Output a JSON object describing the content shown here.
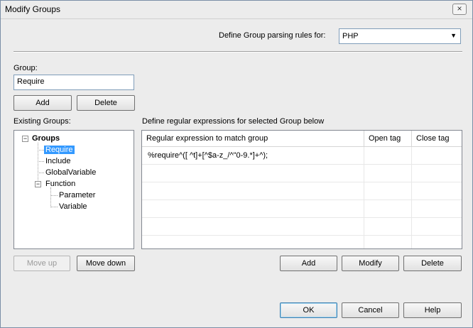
{
  "window": {
    "title": "Modify Groups",
    "close_symbol": "×"
  },
  "parsing": {
    "label": "Define Group parsing rules for:",
    "selected": "PHP",
    "arrow": "▼"
  },
  "group": {
    "label": "Group:",
    "value": "Require",
    "add_label": "Add",
    "delete_label": "Delete"
  },
  "existing": {
    "label": "Existing Groups:",
    "tree": {
      "root": "Groups",
      "items": [
        "Require",
        "Include",
        "GlobalVariable",
        "Function",
        "Parameter",
        "Variable"
      ],
      "expander_minus": "−"
    },
    "move_up_label": "Move up",
    "move_down_label": "Move down"
  },
  "regex": {
    "label": "Define regular expressions for selected Group below",
    "columns": [
      "Regular expression to match group",
      "Open tag",
      "Close tag"
    ],
    "rows": [
      [
        "%require^([ ^t]+[^$a-z_/^\"0-9.*]+^);",
        "",
        ""
      ],
      [
        "",
        "",
        ""
      ],
      [
        "",
        "",
        ""
      ],
      [
        "",
        "",
        ""
      ],
      [
        "",
        "",
        ""
      ],
      [
        "",
        "",
        ""
      ]
    ],
    "add_label": "Add",
    "modify_label": "Modify",
    "delete_label": "Delete"
  },
  "footer": {
    "ok_label": "OK",
    "cancel_label": "Cancel",
    "help_label": "Help"
  }
}
